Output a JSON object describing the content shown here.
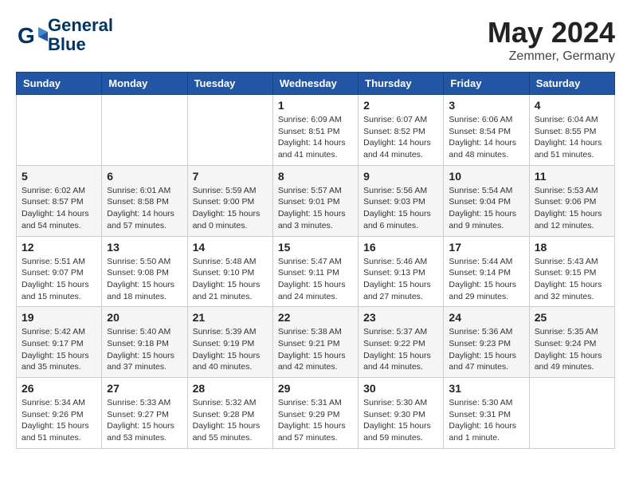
{
  "logo": {
    "line1": "General",
    "line2": "Blue"
  },
  "title": "May 2024",
  "location": "Zemmer, Germany",
  "headers": [
    "Sunday",
    "Monday",
    "Tuesday",
    "Wednesday",
    "Thursday",
    "Friday",
    "Saturday"
  ],
  "weeks": [
    [
      {
        "day": "",
        "info": ""
      },
      {
        "day": "",
        "info": ""
      },
      {
        "day": "",
        "info": ""
      },
      {
        "day": "1",
        "info": "Sunrise: 6:09 AM\nSunset: 8:51 PM\nDaylight: 14 hours\nand 41 minutes."
      },
      {
        "day": "2",
        "info": "Sunrise: 6:07 AM\nSunset: 8:52 PM\nDaylight: 14 hours\nand 44 minutes."
      },
      {
        "day": "3",
        "info": "Sunrise: 6:06 AM\nSunset: 8:54 PM\nDaylight: 14 hours\nand 48 minutes."
      },
      {
        "day": "4",
        "info": "Sunrise: 6:04 AM\nSunset: 8:55 PM\nDaylight: 14 hours\nand 51 minutes."
      }
    ],
    [
      {
        "day": "5",
        "info": "Sunrise: 6:02 AM\nSunset: 8:57 PM\nDaylight: 14 hours\nand 54 minutes."
      },
      {
        "day": "6",
        "info": "Sunrise: 6:01 AM\nSunset: 8:58 PM\nDaylight: 14 hours\nand 57 minutes."
      },
      {
        "day": "7",
        "info": "Sunrise: 5:59 AM\nSunset: 9:00 PM\nDaylight: 15 hours\nand 0 minutes."
      },
      {
        "day": "8",
        "info": "Sunrise: 5:57 AM\nSunset: 9:01 PM\nDaylight: 15 hours\nand 3 minutes."
      },
      {
        "day": "9",
        "info": "Sunrise: 5:56 AM\nSunset: 9:03 PM\nDaylight: 15 hours\nand 6 minutes."
      },
      {
        "day": "10",
        "info": "Sunrise: 5:54 AM\nSunset: 9:04 PM\nDaylight: 15 hours\nand 9 minutes."
      },
      {
        "day": "11",
        "info": "Sunrise: 5:53 AM\nSunset: 9:06 PM\nDaylight: 15 hours\nand 12 minutes."
      }
    ],
    [
      {
        "day": "12",
        "info": "Sunrise: 5:51 AM\nSunset: 9:07 PM\nDaylight: 15 hours\nand 15 minutes."
      },
      {
        "day": "13",
        "info": "Sunrise: 5:50 AM\nSunset: 9:08 PM\nDaylight: 15 hours\nand 18 minutes."
      },
      {
        "day": "14",
        "info": "Sunrise: 5:48 AM\nSunset: 9:10 PM\nDaylight: 15 hours\nand 21 minutes."
      },
      {
        "day": "15",
        "info": "Sunrise: 5:47 AM\nSunset: 9:11 PM\nDaylight: 15 hours\nand 24 minutes."
      },
      {
        "day": "16",
        "info": "Sunrise: 5:46 AM\nSunset: 9:13 PM\nDaylight: 15 hours\nand 27 minutes."
      },
      {
        "day": "17",
        "info": "Sunrise: 5:44 AM\nSunset: 9:14 PM\nDaylight: 15 hours\nand 29 minutes."
      },
      {
        "day": "18",
        "info": "Sunrise: 5:43 AM\nSunset: 9:15 PM\nDaylight: 15 hours\nand 32 minutes."
      }
    ],
    [
      {
        "day": "19",
        "info": "Sunrise: 5:42 AM\nSunset: 9:17 PM\nDaylight: 15 hours\nand 35 minutes."
      },
      {
        "day": "20",
        "info": "Sunrise: 5:40 AM\nSunset: 9:18 PM\nDaylight: 15 hours\nand 37 minutes."
      },
      {
        "day": "21",
        "info": "Sunrise: 5:39 AM\nSunset: 9:19 PM\nDaylight: 15 hours\nand 40 minutes."
      },
      {
        "day": "22",
        "info": "Sunrise: 5:38 AM\nSunset: 9:21 PM\nDaylight: 15 hours\nand 42 minutes."
      },
      {
        "day": "23",
        "info": "Sunrise: 5:37 AM\nSunset: 9:22 PM\nDaylight: 15 hours\nand 44 minutes."
      },
      {
        "day": "24",
        "info": "Sunrise: 5:36 AM\nSunset: 9:23 PM\nDaylight: 15 hours\nand 47 minutes."
      },
      {
        "day": "25",
        "info": "Sunrise: 5:35 AM\nSunset: 9:24 PM\nDaylight: 15 hours\nand 49 minutes."
      }
    ],
    [
      {
        "day": "26",
        "info": "Sunrise: 5:34 AM\nSunset: 9:26 PM\nDaylight: 15 hours\nand 51 minutes."
      },
      {
        "day": "27",
        "info": "Sunrise: 5:33 AM\nSunset: 9:27 PM\nDaylight: 15 hours\nand 53 minutes."
      },
      {
        "day": "28",
        "info": "Sunrise: 5:32 AM\nSunset: 9:28 PM\nDaylight: 15 hours\nand 55 minutes."
      },
      {
        "day": "29",
        "info": "Sunrise: 5:31 AM\nSunset: 9:29 PM\nDaylight: 15 hours\nand 57 minutes."
      },
      {
        "day": "30",
        "info": "Sunrise: 5:30 AM\nSunset: 9:30 PM\nDaylight: 15 hours\nand 59 minutes."
      },
      {
        "day": "31",
        "info": "Sunrise: 5:30 AM\nSunset: 9:31 PM\nDaylight: 16 hours\nand 1 minute."
      },
      {
        "day": "",
        "info": ""
      }
    ]
  ]
}
